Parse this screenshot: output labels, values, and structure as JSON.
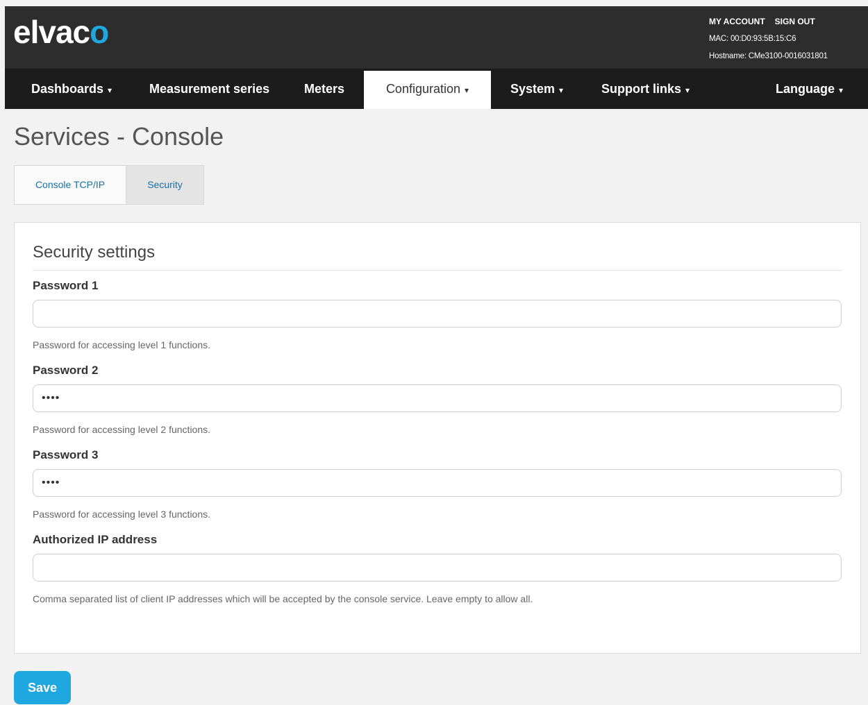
{
  "header": {
    "logo_main": "elvac",
    "logo_accent": "o",
    "my_account": "MY ACCOUNT",
    "sign_out": "SIGN OUT",
    "mac": "MAC: 00:D0:93:5B:15:C6",
    "hostname": "Hostname: CMe3100-0016031801"
  },
  "nav": {
    "dashboards": "Dashboards",
    "measurement_series": "Measurement series",
    "meters": "Meters",
    "configuration": "Configuration",
    "system": "System",
    "support_links": "Support links",
    "language": "Language",
    "caret": "▾"
  },
  "page": {
    "title": "Services - Console"
  },
  "tabs": {
    "console_tcpip": "Console TCP/IP",
    "security": "Security"
  },
  "form": {
    "legend": "Security settings",
    "password1": {
      "label": "Password 1",
      "value": "",
      "help": "Password for accessing level 1 functions."
    },
    "password2": {
      "label": "Password 2",
      "value": "••••",
      "help": "Password for accessing level 2 functions."
    },
    "password3": {
      "label": "Password 3",
      "value": "••••",
      "help": "Password for accessing level 3 functions."
    },
    "authorized_ip": {
      "label": "Authorized IP address",
      "value": "",
      "help": "Comma separated list of client IP addresses which will be accepted by the console service. Leave empty to allow all."
    }
  },
  "actions": {
    "save": "Save"
  },
  "colors": {
    "accent": "#1fa7e0",
    "topbar": "#2d2d2d",
    "navbar": "#1c1c1c"
  }
}
